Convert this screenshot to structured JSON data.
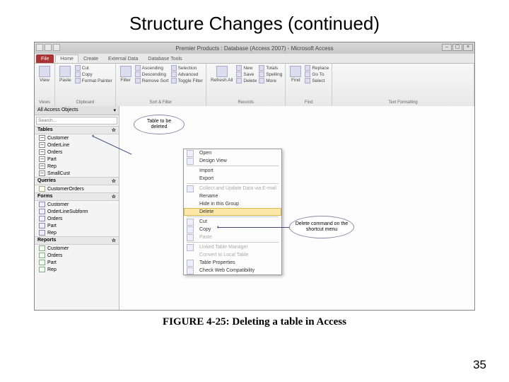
{
  "slide": {
    "title": "Structure Changes (continued)",
    "caption": "FIGURE 4-25: Deleting a table in Access",
    "page": "35"
  },
  "window": {
    "title": "Premier Products : Database (Access 2007) - Microsoft Access"
  },
  "tabs": {
    "file": "File",
    "home": "Home",
    "create": "Create",
    "external": "External Data",
    "dbtools": "Database Tools"
  },
  "ribbon": {
    "views": {
      "label": "Views",
      "view": "View"
    },
    "clipboard": {
      "label": "Clipboard",
      "paste": "Paste",
      "cut": "Cut",
      "copy": "Copy",
      "fmt": "Format Painter"
    },
    "sort": {
      "label": "Sort & Filter",
      "filter": "Filter",
      "asc": "Ascending",
      "desc": "Descending",
      "rem": "Remove Sort",
      "sel": "Selection",
      "adv": "Advanced",
      "tog": "Toggle Filter"
    },
    "records": {
      "label": "Records",
      "refresh": "Refresh\nAll",
      "new": "New",
      "save": "Save",
      "del": "Delete",
      "tot": "Totals",
      "spell": "Spelling",
      "more": "More"
    },
    "find": {
      "label": "Find",
      "find": "Find",
      "repl": "Replace",
      "goto": "Go To",
      "sel": "Select"
    },
    "textfmt": {
      "label": "Text Formatting"
    }
  },
  "nav": {
    "header": "All Access Objects",
    "search_ph": "Search...",
    "tables": {
      "label": "Tables",
      "items": [
        "Customer",
        "OrderLine",
        "Orders",
        "Part",
        "Rep",
        "SmallCust"
      ]
    },
    "queries": {
      "label": "Queries",
      "items": [
        "CustomerOrders"
      ]
    },
    "forms": {
      "label": "Forms",
      "items": [
        "Customer",
        "OrderLineSubform",
        "Orders",
        "Part",
        "Rep"
      ]
    },
    "reports": {
      "label": "Reports",
      "items": [
        "Customer",
        "Orders",
        "Part",
        "Rep"
      ]
    }
  },
  "ctx": {
    "open": "Open",
    "design": "Design View",
    "import": "Import",
    "export": "Export",
    "collect": "Collect and Update Data via E-mail",
    "rename": "Rename",
    "hide": "Hide in this Group",
    "delete": "Delete",
    "cut": "Cut",
    "copy": "Copy",
    "paste": "Paste",
    "linked": "Linked Table Manager",
    "local": "Convert to Local Table",
    "props": "Table Properties",
    "compat": "Check Web Compatibility"
  },
  "callouts": {
    "c1": "Table to be deleted",
    "c2": "Delete command on the shortcut menu"
  }
}
